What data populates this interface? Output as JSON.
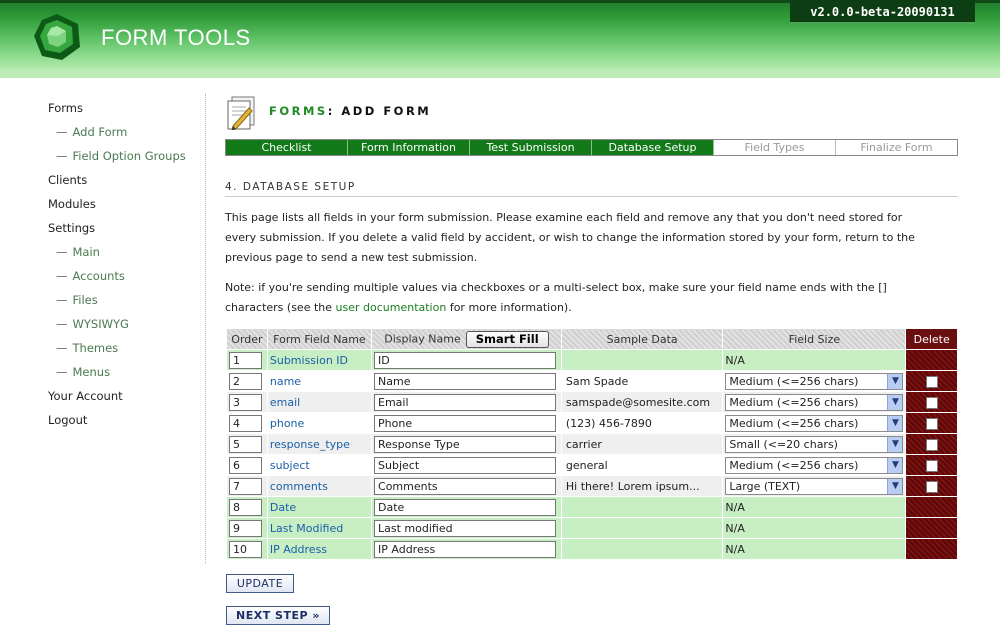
{
  "app": {
    "title": "FORM TOOLS",
    "version": "v2.0.0-beta-20090131"
  },
  "sidebar": {
    "items": [
      {
        "label": "Forms",
        "sub": false
      },
      {
        "label": "Add Form",
        "sub": true
      },
      {
        "label": "Field Option Groups",
        "sub": true
      },
      {
        "label": "Clients",
        "sub": false
      },
      {
        "label": "Modules",
        "sub": false
      },
      {
        "label": "Settings",
        "sub": false
      },
      {
        "label": "Main",
        "sub": true
      },
      {
        "label": "Accounts",
        "sub": true
      },
      {
        "label": "Files",
        "sub": true
      },
      {
        "label": "WYSIWYG",
        "sub": true
      },
      {
        "label": "Themes",
        "sub": true
      },
      {
        "label": "Menus",
        "sub": true
      },
      {
        "label": "Your Account",
        "sub": false
      },
      {
        "label": "Logout",
        "sub": false
      }
    ]
  },
  "page": {
    "title_prefix": "FORMS",
    "title_suffix": ": ADD FORM"
  },
  "steps": [
    {
      "label": "Checklist",
      "done": true
    },
    {
      "label": "Form Information",
      "done": true
    },
    {
      "label": "Test Submission",
      "done": true
    },
    {
      "label": "Database Setup",
      "done": true
    },
    {
      "label": "Field Types",
      "done": false
    },
    {
      "label": "Finalize Form",
      "done": false
    }
  ],
  "section": {
    "title": "4. DATABASE SETUP",
    "para1_line1": "This page lists all fields in your form submission. Please examine each field and remove any that you don't need stored for",
    "para1_line2": "every submission. If you delete a valid field by accident, or wish to change the information stored by your form, return to the",
    "para1_line3": "previous page to send a new test submission.",
    "para2_line1": "Note: if you're sending multiple values via checkboxes or a multi-select box, make sure your field name ends with the []",
    "para2_line2_before": "characters (see the ",
    "para2_link": "user documentation",
    "para2_line2_after": " for more information)."
  },
  "table": {
    "headers": {
      "order": "Order",
      "field_name": "Form Field Name",
      "display_name": "Display Name",
      "smart_fill": "Smart Fill",
      "sample": "Sample Data",
      "size": "Field Size",
      "delete": "Delete"
    },
    "rows": [
      {
        "order": "1",
        "name": "Submission ID",
        "display": "ID",
        "sample": "",
        "size": "N/A",
        "editable": false
      },
      {
        "order": "2",
        "name": "name",
        "display": "Name",
        "sample": "Sam Spade",
        "size": "Medium (<=256 chars)",
        "editable": true
      },
      {
        "order": "3",
        "name": "email",
        "display": "Email",
        "sample": "samspade@somesite.com",
        "size": "Medium (<=256 chars)",
        "editable": true
      },
      {
        "order": "4",
        "name": "phone",
        "display": "Phone",
        "sample": "(123) 456-7890",
        "size": "Medium (<=256 chars)",
        "editable": true
      },
      {
        "order": "5",
        "name": "response_type",
        "display": "Response Type",
        "sample": "carrier",
        "size": "Small (<=20 chars)",
        "editable": true
      },
      {
        "order": "6",
        "name": "subject",
        "display": "Subject",
        "sample": "general",
        "size": "Medium (<=256 chars)",
        "editable": true
      },
      {
        "order": "7",
        "name": "comments",
        "display": "Comments",
        "sample": "Hi there! Lorem ipsum...",
        "size": "Large (TEXT)",
        "editable": true
      },
      {
        "order": "8",
        "name": "Date",
        "display": "Date",
        "sample": "",
        "size": "N/A",
        "editable": false
      },
      {
        "order": "9",
        "name": "Last Modified",
        "display": "Last modified",
        "sample": "",
        "size": "N/A",
        "editable": false
      },
      {
        "order": "10",
        "name": "IP Address",
        "display": "IP Address",
        "sample": "",
        "size": "N/A",
        "editable": false
      }
    ]
  },
  "buttons": {
    "update": "UPDATE",
    "next": "NEXT STEP »"
  }
}
